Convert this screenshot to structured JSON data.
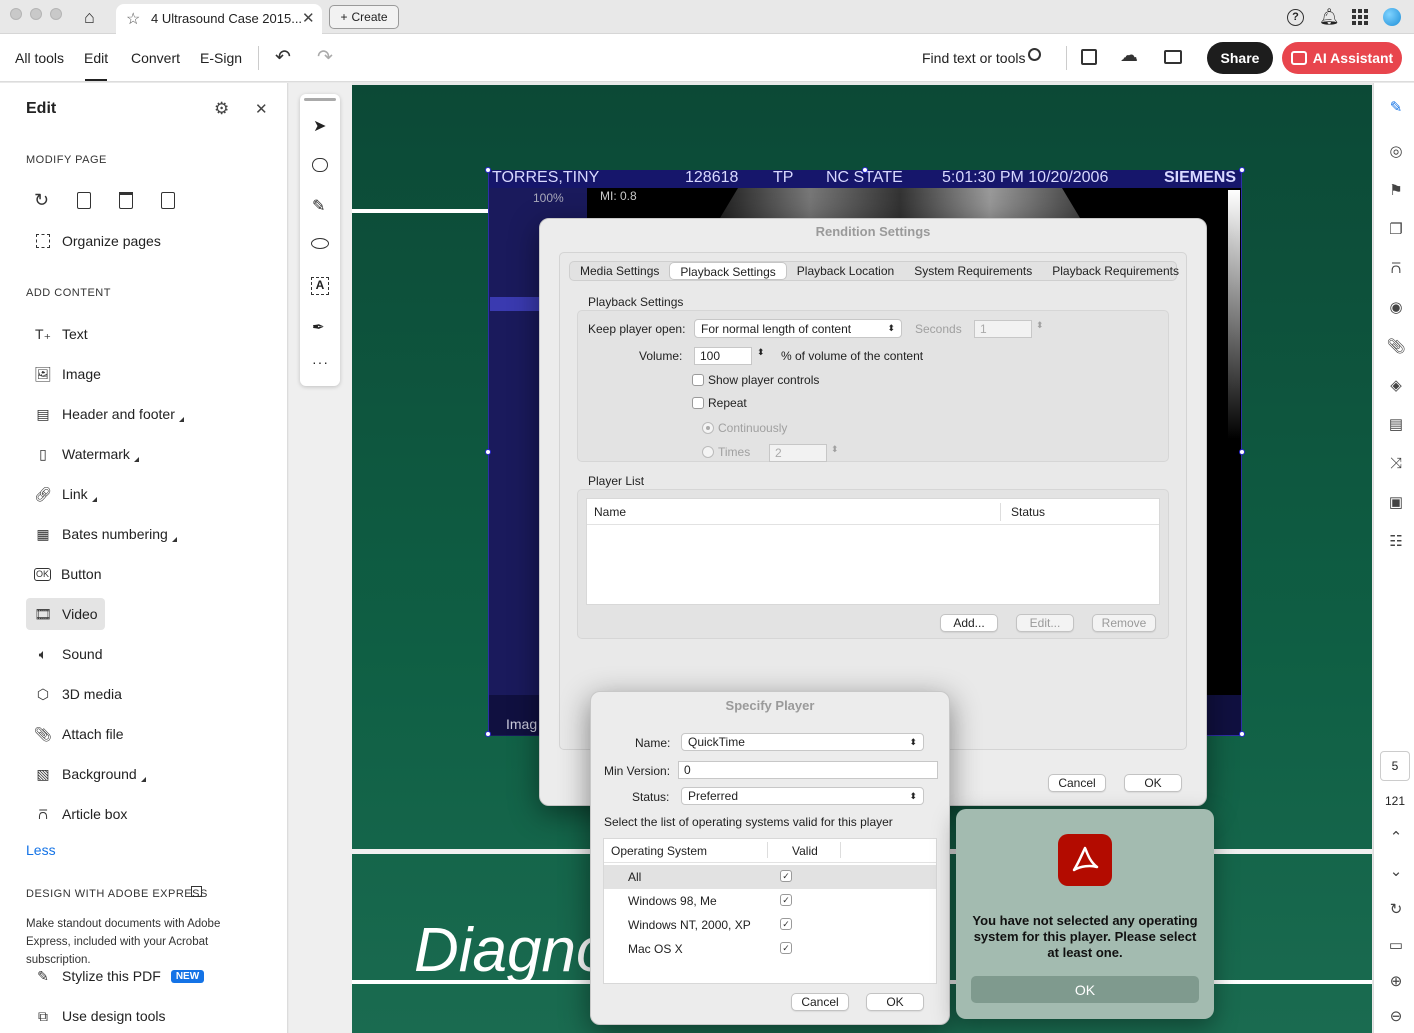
{
  "tab": {
    "title": "4 Ultrasound Case 2015...",
    "create": "Create"
  },
  "menu": {
    "all_tools": "All tools",
    "edit": "Edit",
    "convert": "Convert",
    "esign": "E-Sign",
    "find": "Find text or tools",
    "share": "Share",
    "ai": "AI Assistant"
  },
  "panel": {
    "title": "Edit",
    "modify": "MODIFY PAGE",
    "organize": "Organize pages",
    "add": "ADD CONTENT",
    "items": [
      "Text",
      "Image",
      "Header and footer",
      "Watermark",
      "Link",
      "Bates numbering",
      "Button",
      "Video",
      "Sound",
      "3D media",
      "Attach file",
      "Background",
      "Article box"
    ],
    "less": "Less",
    "design": "DESIGN WITH ADOBE EXPRESS",
    "design_desc": "Make standout documents with Adobe Express, included with your Acrobat subscription.",
    "stylize": "Stylize this PDF",
    "new_badge": "NEW",
    "design_tools": "Use design tools"
  },
  "us": {
    "name": "TORRES,TINY",
    "id": "128618",
    "tp": "TP",
    "site": "NC STATE",
    "time": "5:01:30 PM 10/20/2006",
    "brand": "SIEMENS",
    "mi": "MI: 0.8",
    "pct": "100%",
    "image": "Imag",
    "diag": "Diagno"
  },
  "rendition": {
    "title": "Rendition Settings",
    "tabs": [
      "Media Settings",
      "Playback Settings",
      "Playback Location",
      "System Requirements",
      "Playback Requirements"
    ],
    "group": "Playback Settings",
    "keep_label": "Keep player open:",
    "keep_value": "For normal length of content",
    "seconds": "Seconds",
    "seconds_val": "1",
    "volume_label": "Volume:",
    "volume_val": "100",
    "volume_suffix": "% of volume of the content",
    "show_controls": "Show player controls",
    "repeat": "Repeat",
    "continuously": "Continuously",
    "times": "Times",
    "times_val": "2",
    "player_list": "Player List",
    "col_name": "Name",
    "col_status": "Status",
    "add": "Add...",
    "edit": "Edit...",
    "remove": "Remove",
    "cancel": "Cancel",
    "ok": "OK"
  },
  "specify": {
    "title": "Specify Player",
    "name_label": "Name:",
    "name_val": "QuickTime",
    "minver_label": "Min Version:",
    "minver_val": "0",
    "status_label": "Status:",
    "status_val": "Preferred",
    "instruction": "Select the list of operating systems valid for this player",
    "col_os": "Operating System",
    "col_valid": "Valid",
    "rows": [
      "All",
      "Windows 98, Me",
      "Windows NT, 2000, XP",
      "Mac OS X"
    ],
    "cancel": "Cancel",
    "ok": "OK"
  },
  "alert": {
    "message": "You have not selected any operating system for this player. Please select at least one.",
    "ok": "OK"
  },
  "pages": {
    "current": "5",
    "total": "121"
  }
}
